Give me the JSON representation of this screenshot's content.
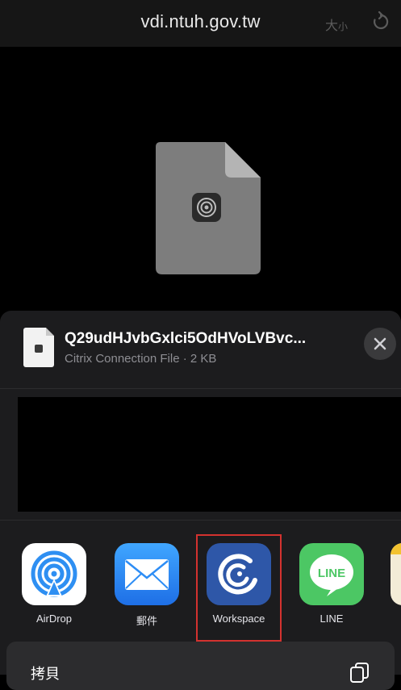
{
  "browser": {
    "url": "vdi.ntuh.gov.tw",
    "text_size_big": "大",
    "text_size_small": "小",
    "reload_icon": "reload-icon"
  },
  "preview": {
    "file_icon": "citrix-document-icon"
  },
  "share_sheet": {
    "file_name": "Q29udHJvbGxlci5OdHVoLVBvc...",
    "file_type": "Citrix Connection File",
    "separator": " · ",
    "file_size": "2 KB",
    "close_icon": "close-icon",
    "apps": [
      {
        "label": "AirDrop",
        "icon": "airdrop-icon"
      },
      {
        "label": "郵件",
        "icon": "mail-icon"
      },
      {
        "label": "Workspace",
        "icon": "citrix-workspace-icon"
      },
      {
        "label": "LINE",
        "icon": "line-icon"
      }
    ],
    "action": {
      "label": "拷貝",
      "icon": "copy-icon"
    },
    "colors": {
      "sheet_bg": "#1c1c1e",
      "highlight": "#d3322f",
      "line_green": "#4cc764",
      "workspace_blue": "#2e57a8",
      "mail_blue": "#2d8df5"
    }
  }
}
